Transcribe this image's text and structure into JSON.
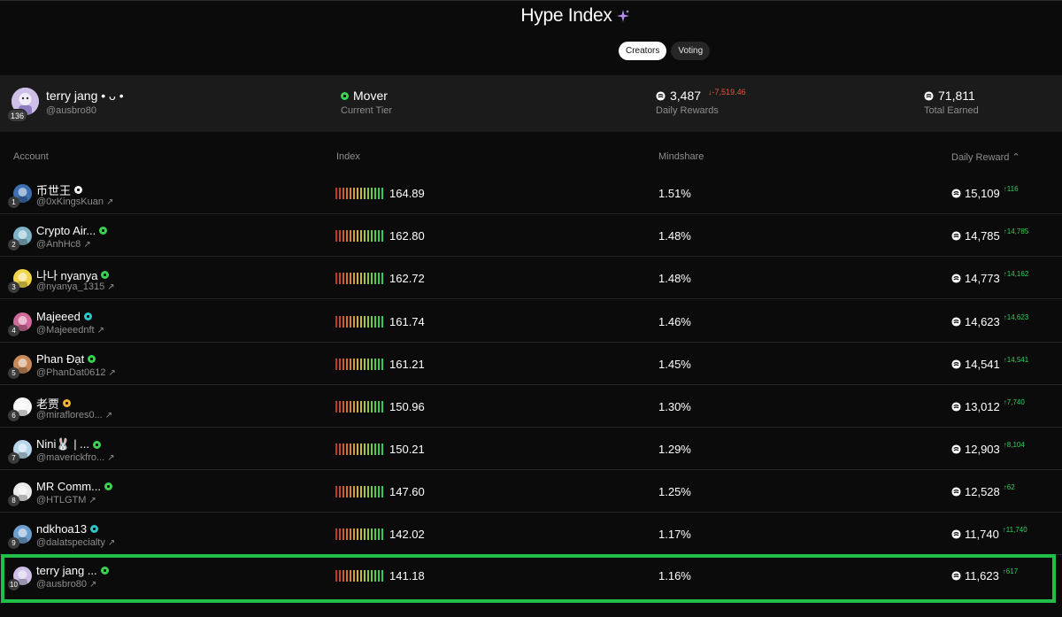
{
  "header": {
    "title": "Hype Index",
    "tabs": [
      {
        "label": "Creators",
        "active": true
      },
      {
        "label": "Voting",
        "active": false
      }
    ]
  },
  "summary": {
    "name": "terry jang • ᴗ •",
    "handle": "@ausbro80",
    "rank_badge": "136",
    "tier": "Mover",
    "tier_label": "Current Tier",
    "daily_rewards": "3,487",
    "daily_rewards_delta": "↓-7,519.46",
    "daily_rewards_label": "Daily Rewards",
    "total_earned": "71,811",
    "total_earned_label": "Total Earned"
  },
  "table": {
    "columns": [
      "Account",
      "Index",
      "Mindshare",
      "Daily Reward ⌃"
    ],
    "rows": [
      {
        "rank": "1",
        "name": "币世王",
        "handle": "@0xKingsKuan",
        "tier_color": "#f2f2f2",
        "index": "164.89",
        "mindshare": "1.51%",
        "reward": "15,109",
        "delta": "↑116",
        "avatar_color": "#3d6fb0"
      },
      {
        "rank": "2",
        "name": "Crypto Air...",
        "handle": "@AnhHc8",
        "tier_color": "#39d353",
        "index": "162.80",
        "mindshare": "1.48%",
        "reward": "14,785",
        "delta": "↑14,785",
        "avatar_color": "#7fb3c7"
      },
      {
        "rank": "3",
        "name": "나나 nyanya",
        "handle": "@nyanya_1315",
        "tier_color": "#39d353",
        "index": "162.72",
        "mindshare": "1.48%",
        "reward": "14,773",
        "delta": "↑14,162",
        "avatar_color": "#f2d44a"
      },
      {
        "rank": "4",
        "name": "Majeeed",
        "handle": "@Majeeednft",
        "tier_color": "#2bc7c9",
        "index": "161.74",
        "mindshare": "1.46%",
        "reward": "14,623",
        "delta": "↑14,623",
        "avatar_color": "#d06a9a"
      },
      {
        "rank": "5",
        "name": "Phan Đạt",
        "handle": "@PhanDat0612",
        "tier_color": "#39d353",
        "index": "161.21",
        "mindshare": "1.45%",
        "reward": "14,541",
        "delta": "↑14,541",
        "avatar_color": "#c98a5a"
      },
      {
        "rank": "6",
        "name": "老贾",
        "handle": "@miraflores0...",
        "tier_color": "#f2b233",
        "index": "150.96",
        "mindshare": "1.30%",
        "reward": "13,012",
        "delta": "↑7,740",
        "avatar_color": "#f5f5f5"
      },
      {
        "rank": "7",
        "name": "Nini🐰 | ...",
        "handle": "@maverickfro...",
        "tier_color": "#39d353",
        "index": "150.21",
        "mindshare": "1.29%",
        "reward": "12,903",
        "delta": "↑8,104",
        "avatar_color": "#b7d6ea"
      },
      {
        "rank": "8",
        "name": "MR Comm...",
        "handle": "@HTLGTM",
        "tier_color": "#39d353",
        "index": "147.60",
        "mindshare": "1.25%",
        "reward": "12,528",
        "delta": "↑62",
        "avatar_color": "#eaeaea"
      },
      {
        "rank": "9",
        "name": "ndkhoa13",
        "handle": "@dalatspecialty",
        "tier_color": "#2bc7c9",
        "index": "142.02",
        "mindshare": "1.17%",
        "reward": "11,740",
        "delta": "↑11,740",
        "avatar_color": "#6f9fcf"
      },
      {
        "rank": "10",
        "name": "terry jang ...",
        "handle": "@ausbro80",
        "tier_color": "#39d353",
        "index": "141.18",
        "mindshare": "1.16%",
        "reward": "11,623",
        "delta": "↑617",
        "avatar_color": "#cdbfe8"
      }
    ]
  },
  "colors": {
    "background": "#0b0b0b",
    "summary_bg": "#1b1b1b",
    "highlight": "#1fbf4a",
    "up": "#2ed05a",
    "down": "#e2573e",
    "sparkle": "#b48cf0"
  },
  "icons": [
    "sparkle-icon",
    "coin-icon",
    "external-link-icon",
    "tier-badge-icon",
    "sort-icon"
  ]
}
